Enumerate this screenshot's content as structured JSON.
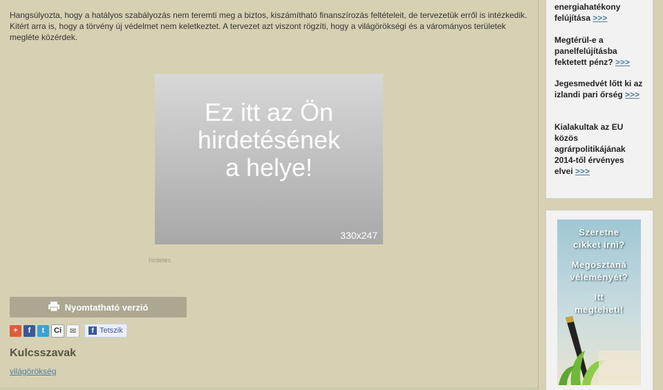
{
  "article": {
    "p1": "Hangsúlyozta, hogy a hatályos szabályozás nem teremti meg a biztos, kiszámítható finanszírozás feltételeit, de tervezetük erről is intézkedik.",
    "p2": "Kitért arra is, hogy a törvény új védelmet nem keletkeztet. A tervezet azt viszont rögzíti, hogy a világörökségi és a várományos területek megléte közérdek."
  },
  "ad": {
    "text": "Ez itt az Ön\nhirdetésének\na helye!",
    "size": "330x247",
    "label": "hirdetés"
  },
  "print_button": {
    "label": "Nyomtatható verzió"
  },
  "share": {
    "like_label": "Tetszik"
  },
  "keywords": {
    "title": "Kulcsszavak",
    "link": "világörökség"
  },
  "sidebar": {
    "more": ">>>",
    "items": [
      {
        "title": "energiahatékony felújítása"
      },
      {
        "title": "Megtérül-e a panelfelújításba fektetett pénz?"
      },
      {
        "title": "Jegesmedvét lőtt ki az izlandi pari őrség"
      },
      {
        "title": "Kialakultak az EU közös agrárpolitikájának 2014-től érvényes elvei"
      }
    ]
  },
  "banner": {
    "lines": [
      "Szeretne",
      "cikket írni?",
      "Megosztaná",
      "véleményét?",
      "Itt",
      "megteheti!"
    ]
  },
  "colors": {
    "background": "#d6d1b2",
    "link": "#4a7da0",
    "button": "#aca790",
    "facebook": "#3b5998"
  }
}
